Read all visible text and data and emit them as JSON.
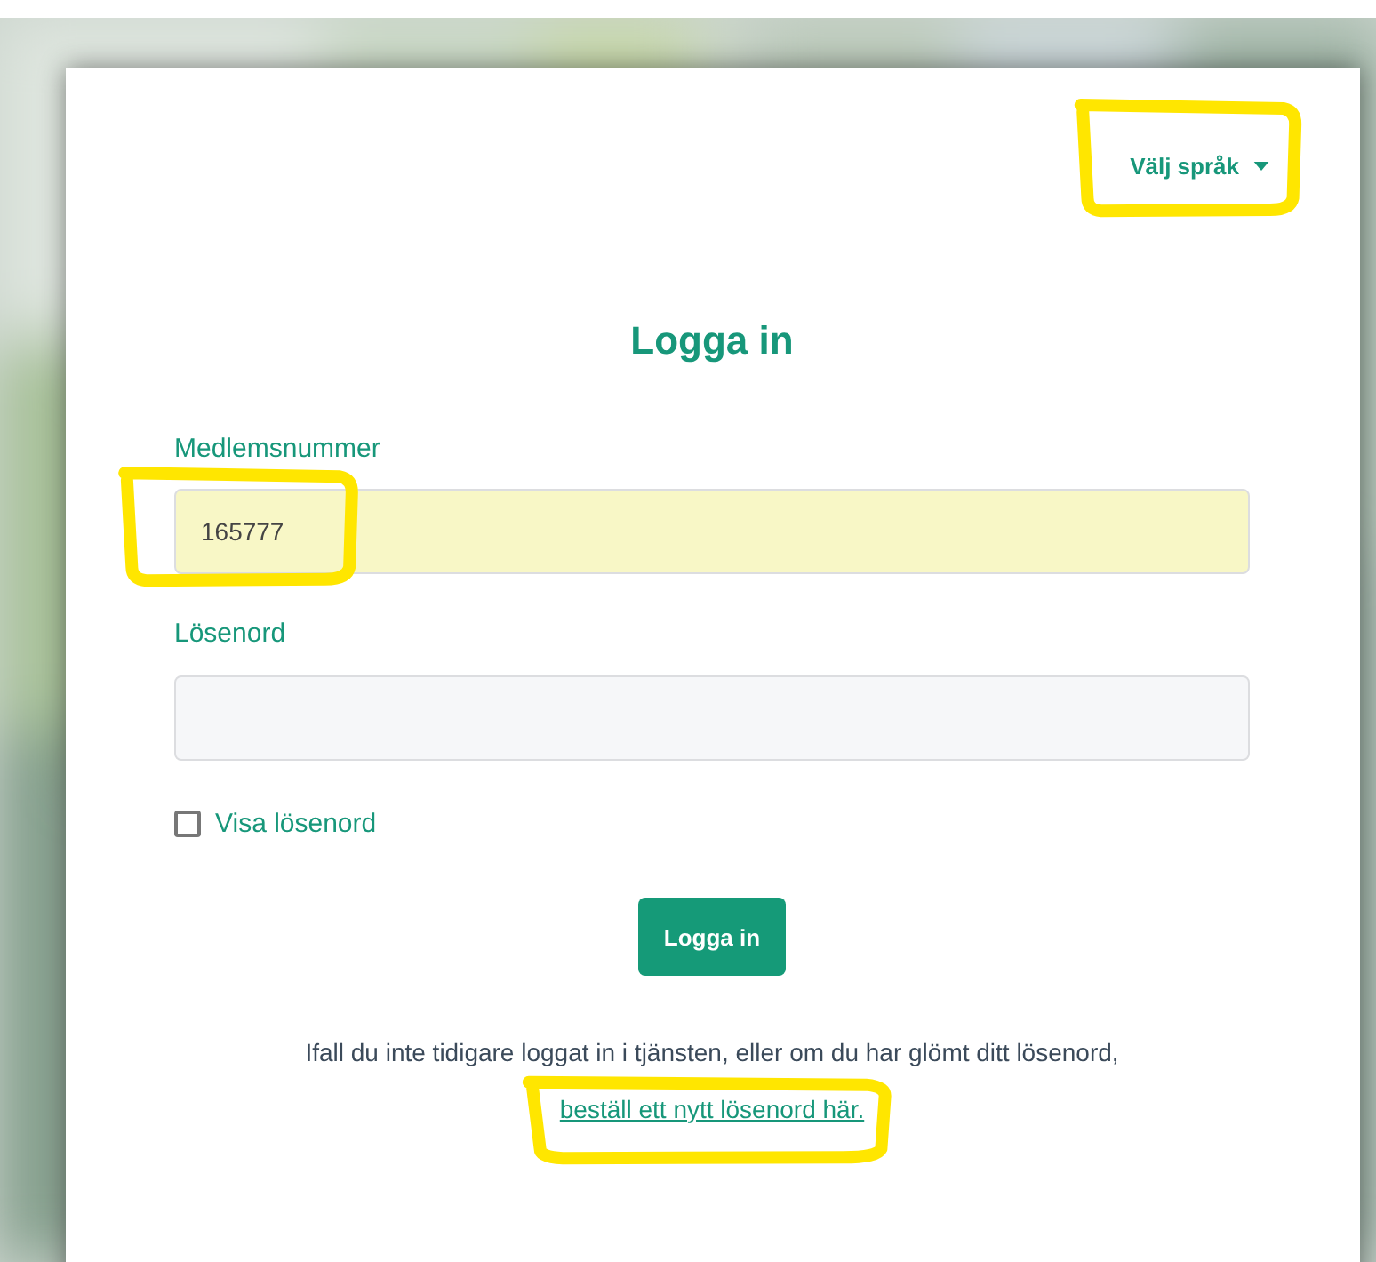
{
  "language_menu": {
    "label": "Välj språk"
  },
  "title": "Logga in",
  "fields": [
    {
      "label": "Medlemsnummer",
      "value": "165777",
      "autofilled": true
    },
    {
      "label": "Lösenord",
      "autofilled": false
    }
  ],
  "checkbox": {
    "label": "Visa lösenord",
    "checked": false
  },
  "submit_button": "Logga in",
  "help": {
    "text": "Ifall du inte tidigare loggat in i tjänsten, eller om du har glömt ditt lösenord,",
    "link": "beställ ett nytt lösenord här."
  }
}
